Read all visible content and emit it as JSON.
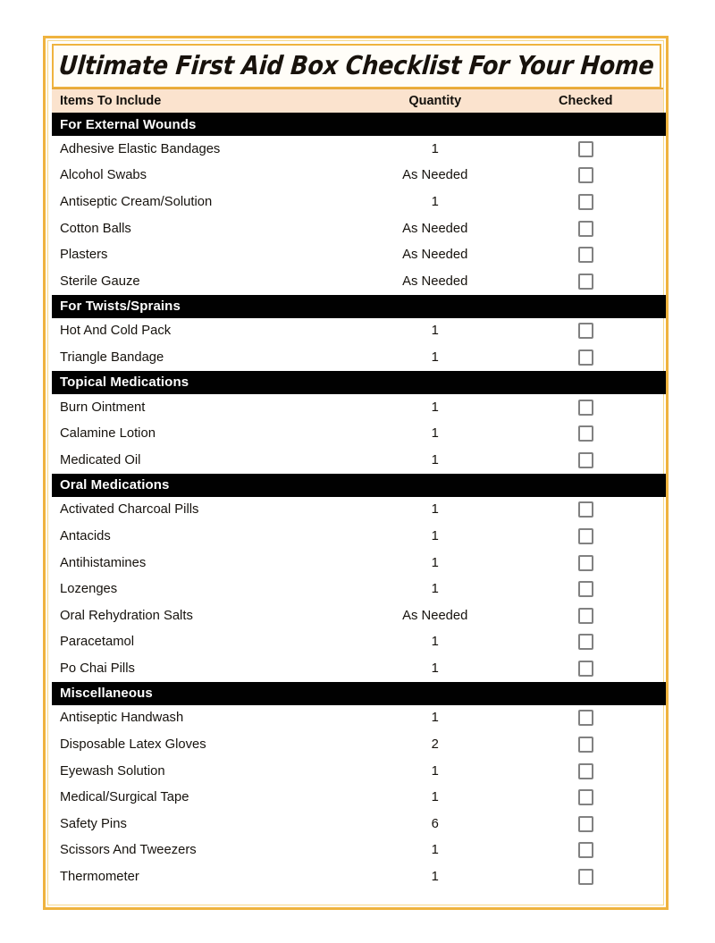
{
  "document": {
    "title": "Ultimate First Aid Box Checklist For Your Home"
  },
  "colors": {
    "frame_gold": "#efb33f",
    "frame_gold_light": "#f6d98c",
    "header_band": "#fbe3ce",
    "section_bar": "#010101",
    "section_text": "#ffffff",
    "body_text": "#16120d",
    "checkbox_border": "#818181",
    "row_background": "#ffffff"
  },
  "table": {
    "columns": [
      {
        "key": "item",
        "label": "Items To Include",
        "align": "left"
      },
      {
        "key": "quantity",
        "label": "Quantity",
        "align": "center"
      },
      {
        "key": "checked",
        "label": "Checked",
        "align": "center"
      }
    ],
    "sections": [
      {
        "title": "For External Wounds",
        "rows": [
          {
            "item": "Adhesive Elastic Bandages",
            "quantity": "1",
            "checked": false
          },
          {
            "item": "Alcohol Swabs",
            "quantity": "As Needed",
            "checked": false
          },
          {
            "item": "Antiseptic Cream/Solution",
            "quantity": "1",
            "checked": false
          },
          {
            "item": "Cotton Balls",
            "quantity": "As Needed",
            "checked": false
          },
          {
            "item": "Plasters",
            "quantity": "As Needed",
            "checked": false
          },
          {
            "item": "Sterile Gauze",
            "quantity": "As Needed",
            "checked": false
          }
        ]
      },
      {
        "title": "For Twists/Sprains",
        "rows": [
          {
            "item": "Hot And Cold Pack",
            "quantity": "1",
            "checked": false
          },
          {
            "item": "Triangle Bandage",
            "quantity": "1",
            "checked": false
          }
        ]
      },
      {
        "title": "Topical Medications",
        "rows": [
          {
            "item": "Burn Ointment",
            "quantity": "1",
            "checked": false
          },
          {
            "item": "Calamine Lotion",
            "quantity": "1",
            "checked": false
          },
          {
            "item": "Medicated Oil",
            "quantity": "1",
            "checked": false
          }
        ]
      },
      {
        "title": "Oral Medications",
        "rows": [
          {
            "item": "Activated Charcoal Pills",
            "quantity": "1",
            "checked": false
          },
          {
            "item": "Antacids",
            "quantity": "1",
            "checked": false
          },
          {
            "item": "Antihistamines",
            "quantity": "1",
            "checked": false
          },
          {
            "item": "Lozenges",
            "quantity": "1",
            "checked": false
          },
          {
            "item": "Oral Rehydration Salts",
            "quantity": "As Needed",
            "checked": false
          },
          {
            "item": "Paracetamol",
            "quantity": "1",
            "checked": false
          },
          {
            "item": "Po Chai Pills",
            "quantity": "1",
            "checked": false
          }
        ]
      },
      {
        "title": "Miscellaneous",
        "rows": [
          {
            "item": "Antiseptic Handwash",
            "quantity": "1",
            "checked": false
          },
          {
            "item": "Disposable Latex Gloves",
            "quantity": "2",
            "checked": false
          },
          {
            "item": "Eyewash Solution",
            "quantity": "1",
            "checked": false
          },
          {
            "item": "Medical/Surgical Tape",
            "quantity": "1",
            "checked": false
          },
          {
            "item": "Safety Pins",
            "quantity": "6",
            "checked": false
          },
          {
            "item": "Scissors And Tweezers",
            "quantity": "1",
            "checked": false
          },
          {
            "item": "Thermometer",
            "quantity": "1",
            "checked": false
          }
        ]
      }
    ]
  }
}
